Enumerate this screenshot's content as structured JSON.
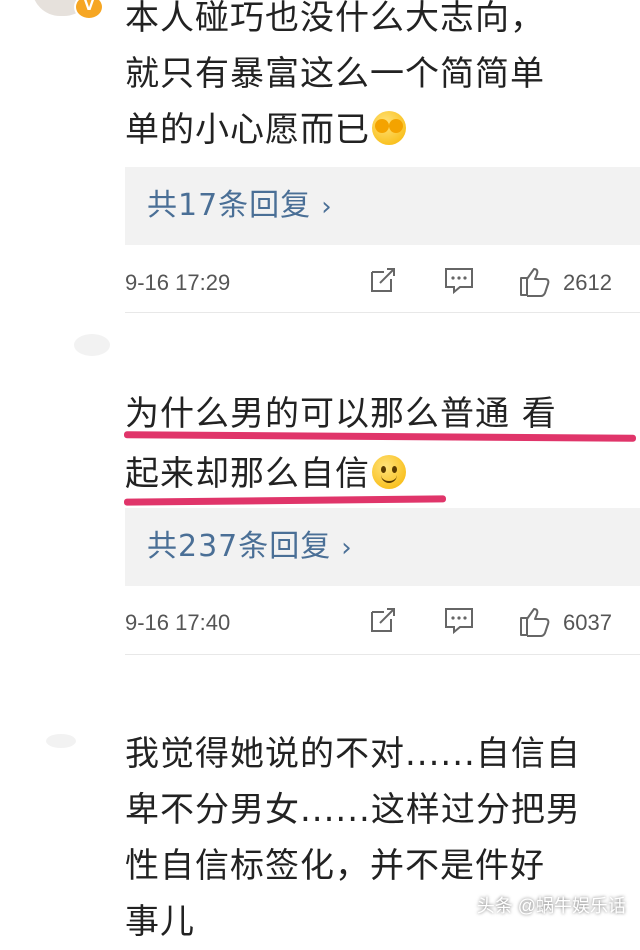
{
  "comments": [
    {
      "text": "本人碰巧也没什么大志向，\n就只有暴富这么一个简简单\n单的小心愿而已",
      "emoji": "covering-face-emoji",
      "reply_label": "共17条回复",
      "reply_chevron": "›",
      "timestamp": "9-16 17:29",
      "likes": "2612"
    },
    {
      "text": "为什么男的可以那么普通 看\n起来却那么自信",
      "emoji": "smiling-face-emoji",
      "reply_label": "共237条回复",
      "reply_chevron": "›",
      "timestamp": "9-16 17:40",
      "likes": "6037"
    },
    {
      "text": "我觉得她说的不对......自信自\n卑不分男女......这样过分把男\n性自信标签化，并不是件好\n事儿"
    }
  ],
  "badge_label": "V",
  "icons": [
    "share-icon",
    "comment-icon",
    "like-icon"
  ],
  "highlight_color": "#e0356a",
  "link_color": "#4a6f96",
  "watermark": "头条 @蜗牛娱乐话"
}
